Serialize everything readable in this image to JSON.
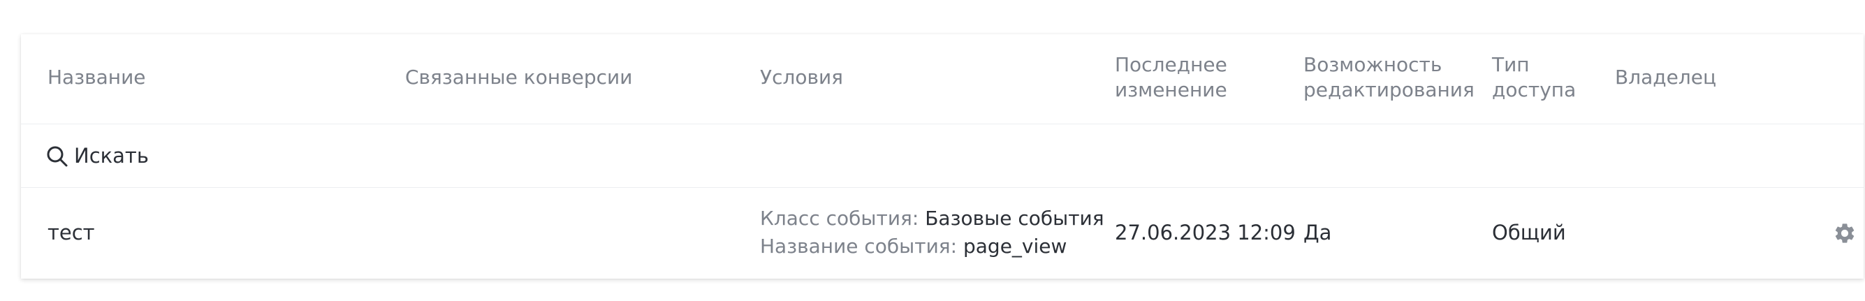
{
  "table": {
    "columns": {
      "name": "Название",
      "linked_conversions": "Связанные конверсии",
      "conditions": "Условия",
      "last_modified": [
        "Последнее",
        "изменение"
      ],
      "editable": [
        "Возможность",
        "редактирования"
      ],
      "access_type": [
        "Тип",
        "доступа"
      ],
      "owner": "Владелец"
    },
    "search": {
      "placeholder": "Искать",
      "value": ""
    },
    "rows": [
      {
        "name": "тест",
        "linked_conversions": "",
        "conditions": {
          "event_class_label": "Класс события:",
          "event_class_value": "Базовые события",
          "event_name_label": "Название события:",
          "event_name_value": "page_view"
        },
        "last_modified": "27.06.2023 12:09",
        "editable": "Да",
        "access_type": "Общий",
        "owner": "",
        "settings_icon": "gear-icon"
      }
    ]
  },
  "colors": {
    "header_text": "#7d828b",
    "body_text": "#2b2f36",
    "divider": "#eceef0",
    "icon": "#8a8f97"
  }
}
